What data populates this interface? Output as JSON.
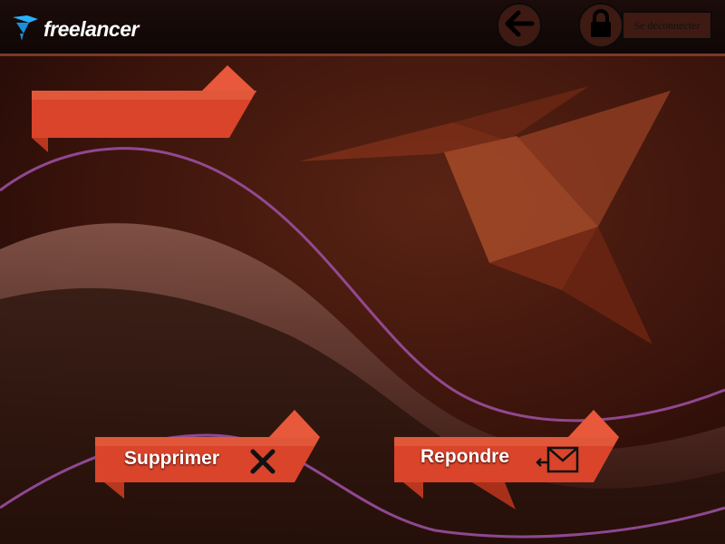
{
  "header": {
    "logo_text": "freelancer",
    "logout_label": "Se déconnecter"
  },
  "main": {
    "title_banner_label": "",
    "delete_label": "Supprimer",
    "reply_label": "Repondre"
  },
  "icons": {
    "logo": "bird-logo-icon",
    "back": "arrow-left-icon",
    "lock": "lock-icon",
    "delete": "x-icon",
    "reply": "envelope-icon"
  },
  "colors": {
    "accent": "#e04a30",
    "background": "#3a140c",
    "wave": "#8a3f8e"
  }
}
